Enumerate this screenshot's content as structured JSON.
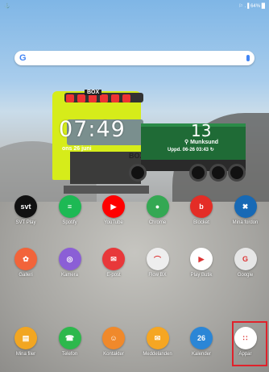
{
  "statusbar": {
    "left": "⚓",
    "right": "⚐ .▐ 64% █"
  },
  "clock": {
    "time": "07:49",
    "date": "ons 26 juni"
  },
  "weather": {
    "temp": "13",
    "location": "Munksund",
    "updated": "Uppd. 06-26 03:43"
  },
  "truck": {
    "top_logo": "BOX",
    "side_logo": "BOX"
  },
  "apps_row1": [
    {
      "label": "SVT Play",
      "icon": "svt-play-icon",
      "text": "svt",
      "color": "#111111"
    },
    {
      "label": "Spotify",
      "icon": "spotify-icon",
      "text": "≡",
      "color": "#1db954"
    },
    {
      "label": "YouTube",
      "icon": "youtube-icon",
      "text": "▶",
      "color": "#ff0000"
    },
    {
      "label": "Chrome",
      "icon": "chrome-icon",
      "text": "●",
      "color": "#34a853"
    },
    {
      "label": "Blocket",
      "icon": "blocket-icon",
      "text": "b",
      "color": "#e42d26"
    },
    {
      "label": "Mina fordon",
      "icon": "mina-fordon-icon",
      "text": "✖",
      "color": "#1769b5"
    }
  ],
  "apps_row2": [
    {
      "label": "Galleri",
      "icon": "gallery-icon",
      "text": "✿",
      "color": "#f2643a"
    },
    {
      "label": "Kamera",
      "icon": "camera-icon",
      "text": "◎",
      "color": "#8b5fd6"
    },
    {
      "label": "E-post",
      "icon": "email-icon",
      "text": "✉",
      "color": "#e8383a"
    },
    {
      "label": "Flow BX",
      "icon": "flow-bx-icon",
      "text": "⌒",
      "color": "#eeeeee"
    },
    {
      "label": "Play Butik",
      "icon": "play-store-icon",
      "text": "▶",
      "color": "#ffffff"
    },
    {
      "label": "Google",
      "icon": "google-folder-icon",
      "text": "G",
      "color": "#e6e6e6"
    }
  ],
  "dock": [
    {
      "label": "Mina filer",
      "icon": "files-icon",
      "text": "▤",
      "color": "#f2a622"
    },
    {
      "label": "Telefon",
      "icon": "phone-icon",
      "text": "☎",
      "color": "#2db84c"
    },
    {
      "label": "Kontakter",
      "icon": "contacts-icon",
      "text": "☺",
      "color": "#f0892b"
    },
    {
      "label": "Meddelanden",
      "icon": "messages-icon",
      "text": "✉",
      "color": "#f5a623"
    },
    {
      "label": "Kalender",
      "icon": "calendar-icon",
      "text": "26",
      "color": "#2b86d6"
    },
    {
      "label": "Appar",
      "icon": "apps-grid-icon",
      "text": "∷",
      "color": "#ffffff"
    }
  ]
}
